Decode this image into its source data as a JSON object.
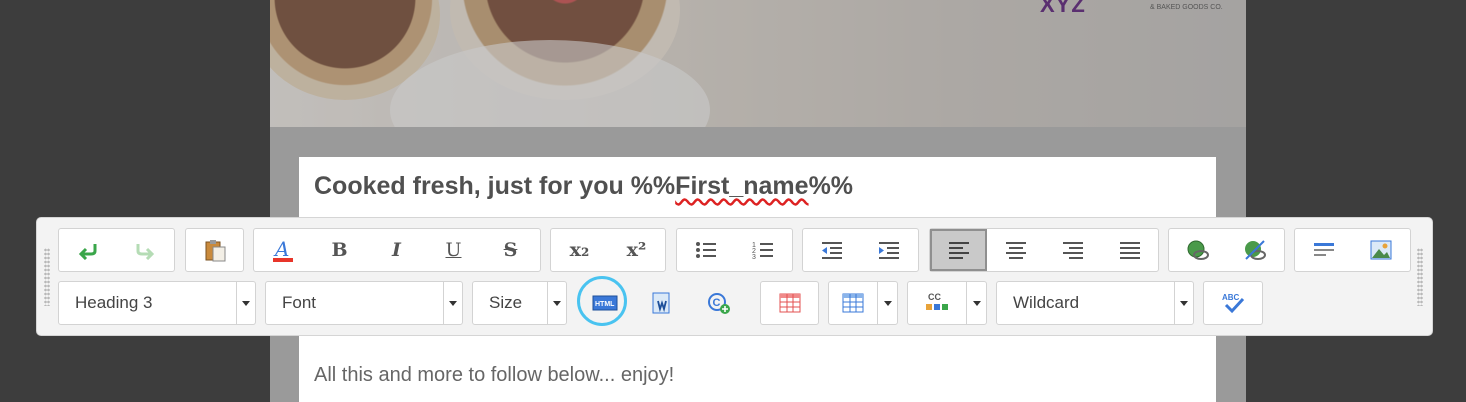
{
  "logo": {
    "text": "XYZ",
    "tagline": "& BAKED GOODS CO."
  },
  "content": {
    "heading_prefix": "Cooked fresh, just for you %%",
    "heading_spell": "First_name",
    "heading_suffix": "%%",
    "body": "All this and more to follow below... enjoy!"
  },
  "toolbar": {
    "style_select": "Heading 3",
    "font_select": "Font",
    "size_select": "Size",
    "wildcard_select": "Wildcard",
    "icons": {
      "undo": "undo-icon",
      "redo": "redo-icon",
      "paste": "paste-icon",
      "font_color": "font-color-icon",
      "bold": "B",
      "italic": "I",
      "underline": "U",
      "strike": "S",
      "subscript": "x₂",
      "superscript": "x²",
      "bullet_list": "bulleted-list-icon",
      "numbered_list": "numbered-list-icon",
      "outdent": "outdent-icon",
      "indent": "indent-icon",
      "align_left": "align-left-icon",
      "align_center": "align-center-icon",
      "align_right": "align-right-icon",
      "justify": "justify-icon",
      "link": "link-icon",
      "unlink": "unlink-icon",
      "hr": "horizontal-rule-icon",
      "image": "image-icon",
      "html": "HTML",
      "cc_label": "CC",
      "spell": "ABC"
    }
  },
  "colors": {
    "accent_ring": "#49c3f0",
    "undo_green": "#3aa64a",
    "font_a": "#3a78d8",
    "font_bar": "#e8352a"
  }
}
